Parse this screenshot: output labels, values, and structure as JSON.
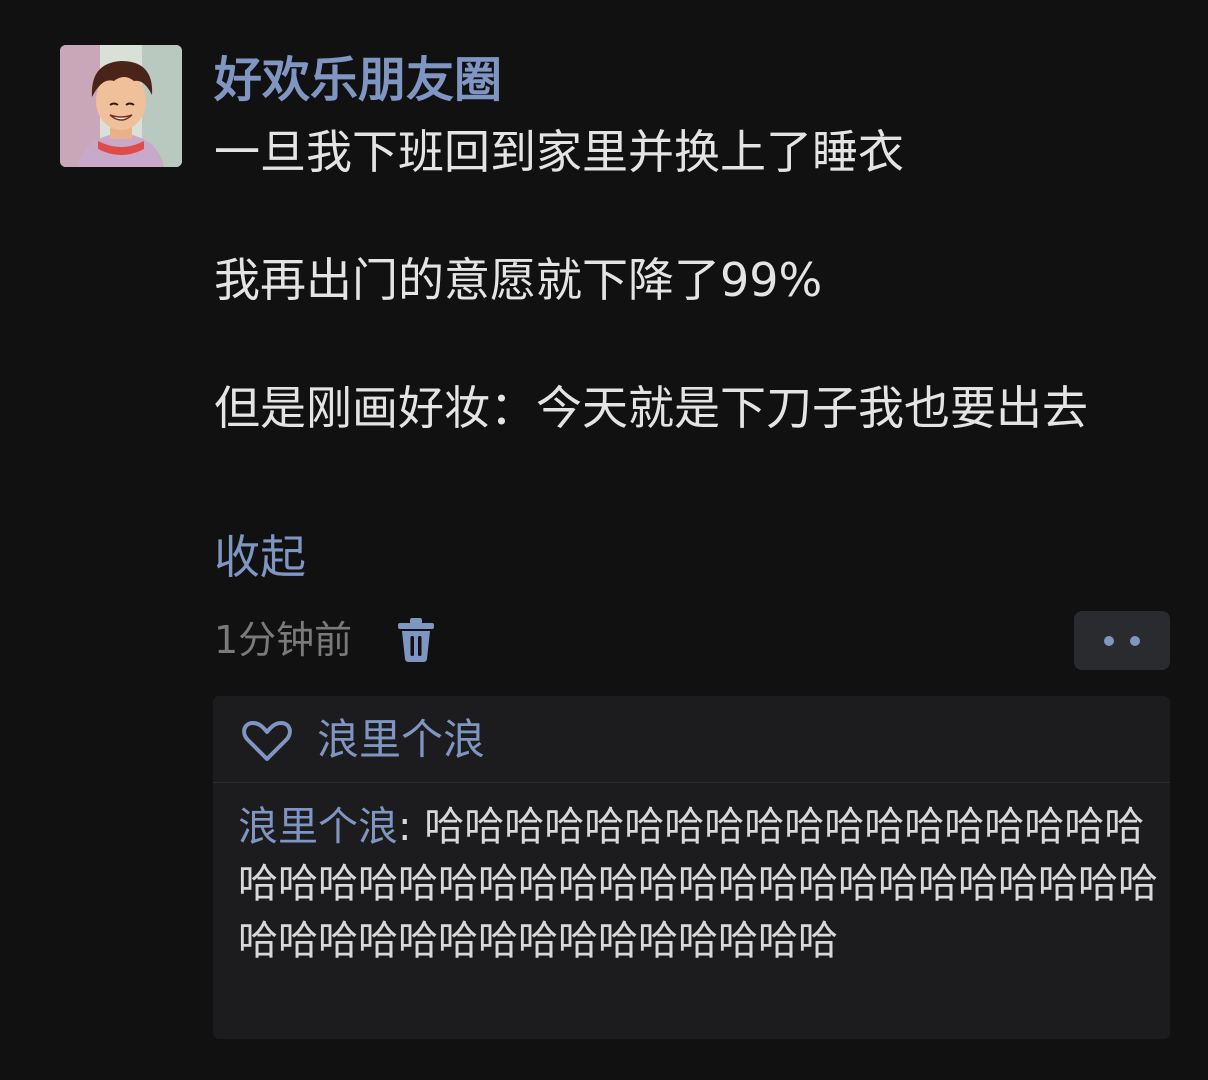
{
  "post": {
    "username": "好欢乐朋友圈",
    "lines": [
      "一旦我下班回到家里并换上了睡衣",
      "我再出门的意愿就下降了99%",
      "但是刚画好妆：今天就是下刀子我也要出去"
    ],
    "collapse_label": "收起",
    "timestamp": "1分钟前",
    "delete_icon": "trash-icon",
    "more_icon": "more-dots-icon"
  },
  "likes": {
    "icon": "heart-outline-icon",
    "names": "浪里个浪"
  },
  "comment": {
    "author": "浪里个浪",
    "separator": ": ",
    "text": "哈哈哈哈哈哈哈哈哈哈哈哈哈哈哈哈哈哈哈哈哈哈哈哈哈哈哈哈哈哈哈哈哈哈哈哈哈哈哈哈哈哈哈哈哈哈哈哈哈哈哈哈哈哈哈哈"
  },
  "colors": {
    "background": "#111111",
    "accent": "#7f96c2",
    "text": "#e4e4e4",
    "muted": "#7a7a7a",
    "panel": "#1c1c1e"
  }
}
